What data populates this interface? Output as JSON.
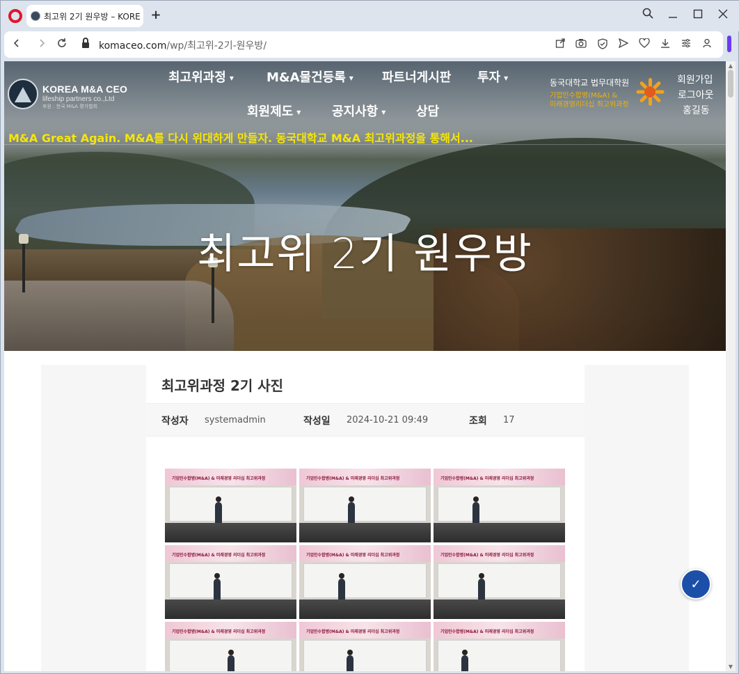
{
  "browser": {
    "tab_title": "최고위 2기 원우방 – KORE",
    "new_tab": "+",
    "url_host": "komaceo.com",
    "url_path": "/wp/최고위-2기-원우방/",
    "icons": [
      "opera-logo-icon",
      "back-icon",
      "forward-icon",
      "reload-icon",
      "lock-icon",
      "share-icon",
      "camera-icon",
      "shield-icon",
      "send-icon",
      "heart-icon",
      "download-icon",
      "easy-setup-icon",
      "profile-icon",
      "search-icon",
      "minimize-icon",
      "maximize-icon",
      "close-icon"
    ]
  },
  "site": {
    "logo_title": "KOREA M&A CEO",
    "logo_subtitle": "lifeship partners co.,Ltd",
    "logo_tagline": "후원 : 한국 M&A 평가협회",
    "nav": [
      {
        "label": "최고위과정",
        "dropdown": true
      },
      {
        "label": "M&A물건등록",
        "dropdown": true
      },
      {
        "label": "파트너게시판",
        "dropdown": false
      },
      {
        "label": "투자",
        "dropdown": true
      },
      {
        "label": "회원제도",
        "dropdown": true
      },
      {
        "label": "공지사항",
        "dropdown": true
      },
      {
        "label": "상담",
        "dropdown": false
      }
    ],
    "partner": {
      "line1": "동국대학교 법무대학원",
      "line2": "기업인수합병(M&A) &",
      "line3": "미래경영리더십 최고위과정"
    },
    "auth": {
      "signup": "회원가입",
      "logout": "로그아웃",
      "user": "홍길동"
    },
    "marquee": "M&A Great Again. M&A를 다시 위대하게 만들자. 동국대학교 M&A 최고위과정을 통해서...",
    "hero_title": "최고위 2기 원우방"
  },
  "post": {
    "title": "최고위과정 2기 사진",
    "author_label": "작성자",
    "author": "systemadmin",
    "date_label": "작성일",
    "date": "2024-10-21 09:49",
    "views_label": "조회",
    "views": "17",
    "photo_banner": "기업인수합병(M&A) & 미래경영 리더십 최고위과정",
    "photos": 9
  },
  "colors": {
    "marquee": "#f5e60a",
    "partner_accent": "#f2b400",
    "a11y_button": "#1c4fa8",
    "opera_red": "#e0162b"
  },
  "a11y_button": "accessibility-icon"
}
